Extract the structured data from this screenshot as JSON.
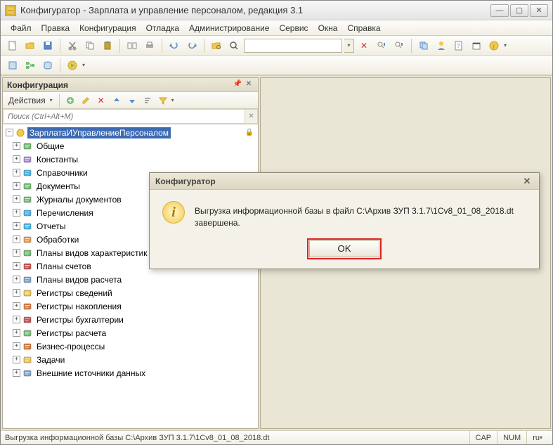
{
  "window": {
    "title": "Конфигуратор - Зарплата и управление персоналом, редакция 3.1"
  },
  "menu": {
    "items": [
      "Файл",
      "Правка",
      "Конфигурация",
      "Отладка",
      "Администрирование",
      "Сервис",
      "Окна",
      "Справка"
    ]
  },
  "panel": {
    "title": "Конфигурация",
    "actions_label": "Действия"
  },
  "search": {
    "placeholder": "Поиск (Ctrl+Alt+M)"
  },
  "tree": {
    "root": "ЗарплатаИУправлениеПерсоналом",
    "items": [
      {
        "label": "Общие",
        "icon": "common"
      },
      {
        "label": "Константы",
        "icon": "constants"
      },
      {
        "label": "Справочники",
        "icon": "catalogs"
      },
      {
        "label": "Документы",
        "icon": "documents"
      },
      {
        "label": "Журналы документов",
        "icon": "journals"
      },
      {
        "label": "Перечисления",
        "icon": "enums"
      },
      {
        "label": "Отчеты",
        "icon": "reports"
      },
      {
        "label": "Обработки",
        "icon": "processing"
      },
      {
        "label": "Планы видов характеристик",
        "icon": "chart-char"
      },
      {
        "label": "Планы счетов",
        "icon": "chart-acc"
      },
      {
        "label": "Планы видов расчета",
        "icon": "chart-calc"
      },
      {
        "label": "Регистры сведений",
        "icon": "info-reg"
      },
      {
        "label": "Регистры накопления",
        "icon": "accum-reg"
      },
      {
        "label": "Регистры бухгалтерии",
        "icon": "acc-reg"
      },
      {
        "label": "Регистры расчета",
        "icon": "calc-reg"
      },
      {
        "label": "Бизнес-процессы",
        "icon": "bp"
      },
      {
        "label": "Задачи",
        "icon": "tasks"
      },
      {
        "label": "Внешние источники данных",
        "icon": "ext-data"
      }
    ]
  },
  "dialog": {
    "title": "Конфигуратор",
    "message": "Выгрузка информационной базы в файл С:\\Архив ЗУП 3.1.7\\1Cv8_01_08_2018.dt завершена.",
    "ok": "OK"
  },
  "status": {
    "text": "Выгрузка информационной базы С:\\Архив ЗУП 3.1.7\\1Cv8_01_08_2018.dt",
    "cap": "CAP",
    "num": "NUM",
    "lang": "ru"
  },
  "icons": {
    "colors": {
      "common": "#6fbf73",
      "constants": "#b088d8",
      "catalogs": "#46b3e6",
      "documents": "#6fbf73",
      "journals": "#6fbf73",
      "enums": "#46b3e6",
      "reports": "#46b3e6",
      "processing": "#f2994a",
      "chart-char": "#6fbf73",
      "chart-acc": "#c94f4f",
      "chart-calc": "#7aa5d2",
      "info-reg": "#f2c94c",
      "accum-reg": "#e07a3f",
      "acc-reg": "#c94f4f",
      "calc-reg": "#6fbf73",
      "bp": "#e07a3f",
      "tasks": "#f2c94c",
      "ext-data": "#7aa5d2"
    }
  }
}
